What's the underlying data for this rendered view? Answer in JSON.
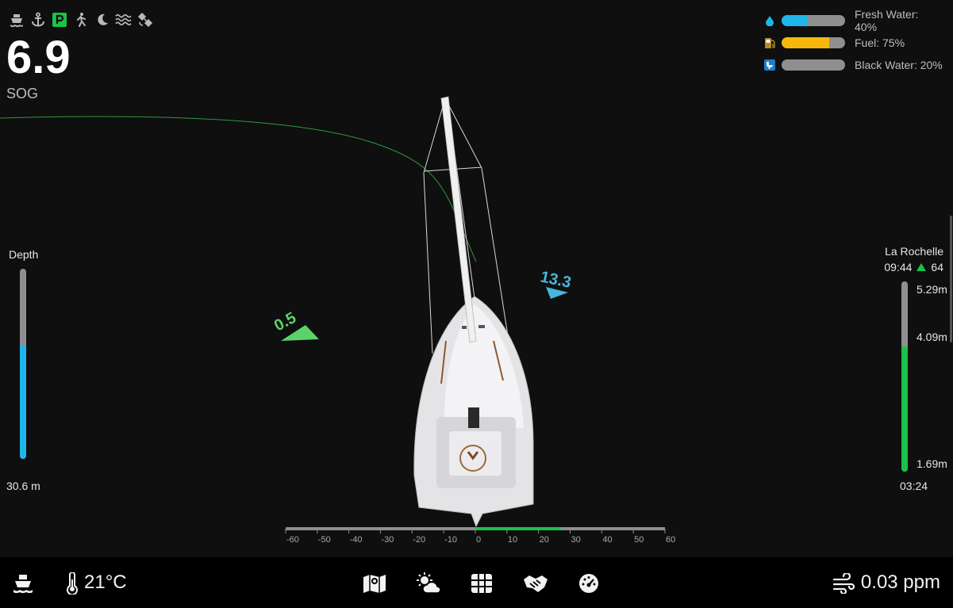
{
  "status_icons": [
    "boat-icon",
    "anchor-icon",
    "parking-icon",
    "crew-icon",
    "night-mode-icon",
    "waves-icon",
    "satellite-icon"
  ],
  "colors": {
    "background": "#0f0f0f",
    "accent_blue": "#1eb6ea",
    "accent_green": "#19c24a",
    "fuel_yellow": "#f5b80b",
    "track_grey": "#8f8f8f"
  },
  "sog": {
    "value": "6.9",
    "label": "SOG"
  },
  "tanks": [
    {
      "icon": "water-drop-icon",
      "label": "Fresh Water: 40%",
      "level": 0.4,
      "color": "#1eb6ea"
    },
    {
      "icon": "fuel-pump-icon",
      "label": "Fuel: 75%",
      "level": 0.75,
      "color": "#f5b80b"
    },
    {
      "icon": "toilet-icon",
      "label": "Black Water: 20%",
      "level": 0.2,
      "color": "#8f8f8f"
    }
  ],
  "depth": {
    "title": "Depth",
    "value": "30.6 m",
    "level": 0.6
  },
  "tide": {
    "place": "La Rochelle",
    "time": "09:44",
    "trend_icon": "triangle-up-icon",
    "coefficient": "64",
    "high": "5.29m",
    "current": "4.09m",
    "low": "1.69m",
    "next_time": "03:24",
    "level": 0.66
  },
  "wind": {
    "apparent_angle": "0.5",
    "true_speed": "13.3"
  },
  "rudder_scale": {
    "ticks": [
      "-60",
      "-50",
      "-40",
      "-30",
      "-20",
      "-10",
      "0",
      "10",
      "20",
      "30",
      "40",
      "50",
      "60"
    ],
    "angle_range": [
      0,
      27
    ]
  },
  "bottom": {
    "temperature": "21°C",
    "air_quality": "0.03 ppm",
    "nav_buttons": [
      "map-icon",
      "weather-icon",
      "grid-icon",
      "handshake-icon",
      "gauge-icon"
    ]
  }
}
